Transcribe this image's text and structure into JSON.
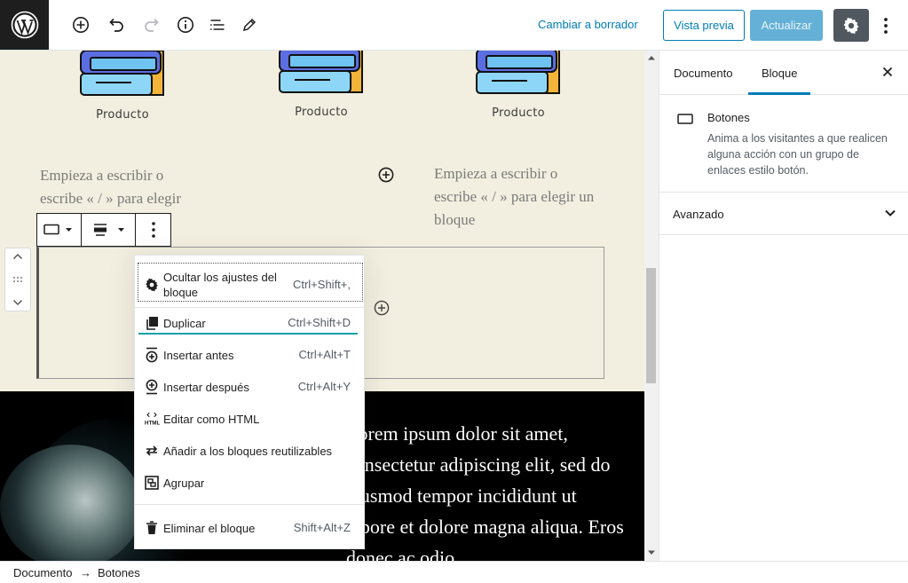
{
  "topbar": {
    "switch_draft": "Cambiar a borrador",
    "preview": "Vista previa",
    "update": "Actualizar",
    "icons": [
      "wordpress-logo-icon",
      "add-block-icon",
      "undo-icon",
      "redo-icon",
      "info-icon",
      "outline-icon",
      "edit-icon",
      "settings-icon",
      "more-options-icon"
    ]
  },
  "canvas": {
    "products": [
      "Producto",
      "Producto",
      "Producto"
    ],
    "placeholder_left": "Empieza a escribir o escribe « / » para elegir",
    "placeholder_right": "Empieza a escribir o escribe « / » para elegir un bloque",
    "lorem": "Lorem ipsum dolor sit amet, consectetur adipiscing elit, sed do eiusmod tempor incididunt ut labore et dolore magna aliqua. Eros donec ac odio"
  },
  "menu": {
    "items": [
      {
        "label": "Ocultar los ajustes del bloque",
        "shortcut": "Ctrl+Shift+,",
        "icon": "gear-icon"
      },
      {
        "label": "Duplicar",
        "shortcut": "Ctrl+Shift+D",
        "icon": "duplicate-icon"
      },
      {
        "label": "Insertar antes",
        "shortcut": "Ctrl+Alt+T",
        "icon": "insert-before-icon"
      },
      {
        "label": "Insertar después",
        "shortcut": "Ctrl+Alt+Y",
        "icon": "insert-after-icon"
      },
      {
        "label": "Editar como HTML",
        "shortcut": "",
        "icon": "html-icon"
      },
      {
        "label": "Añadir a los bloques reutilizables",
        "shortcut": "",
        "icon": "reusable-icon"
      },
      {
        "label": "Agrupar",
        "shortcut": "",
        "icon": "group-icon"
      },
      {
        "label": "Eliminar el bloque",
        "shortcut": "Shift+Alt+Z",
        "icon": "trash-icon"
      }
    ]
  },
  "sidebar": {
    "tabs": [
      "Documento",
      "Bloque"
    ],
    "active_tab": "Bloque",
    "block_title": "Botones",
    "block_description": "Anima a los visitantes a que realicen alguna acción con un grupo de enlaces estilo botón.",
    "advanced": "Avanzado"
  },
  "footer": {
    "crumbs": [
      "Documento",
      "Botones"
    ],
    "separator": "→"
  },
  "colors": {
    "accent": "#007cba",
    "canvas_bg": "#f3efe0",
    "dark_section": "#000000"
  }
}
